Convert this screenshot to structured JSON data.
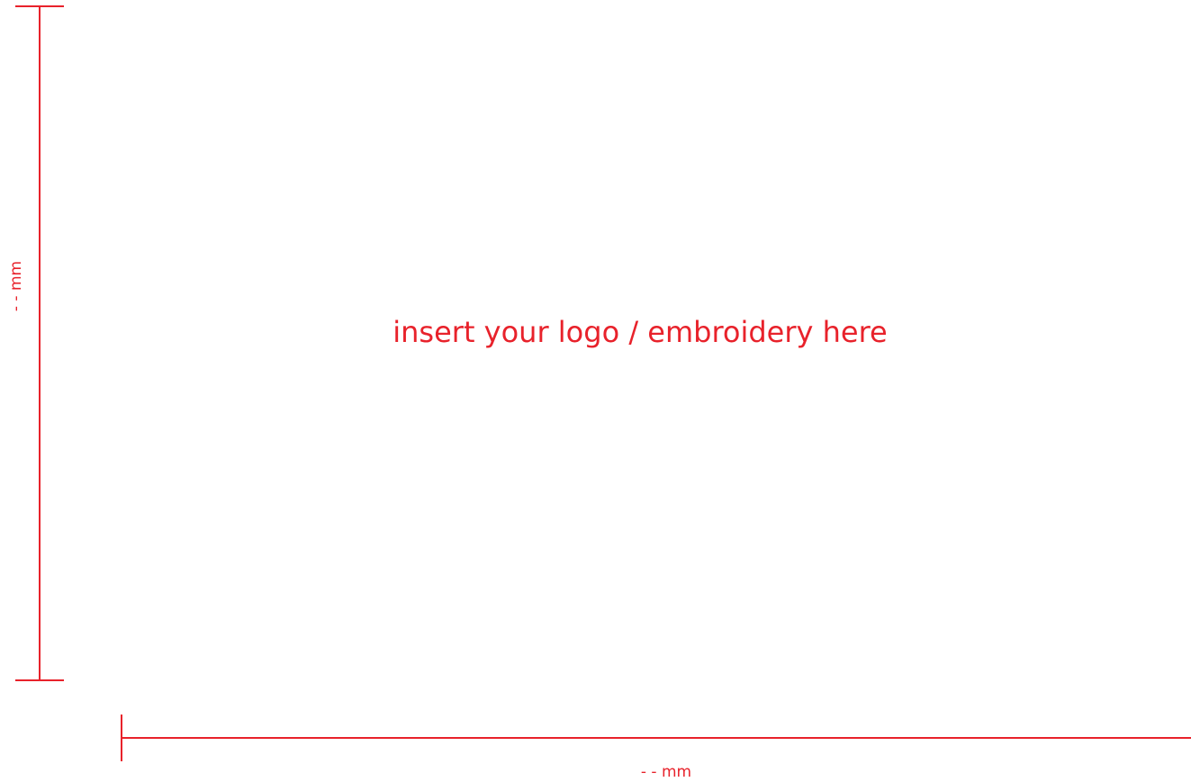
{
  "placeholder_text": "insert your logo / embroidery here",
  "height_label": "- - mm",
  "width_label": "- - mm",
  "colors": {
    "accent": "#e8222b",
    "background": "#ffffff"
  }
}
